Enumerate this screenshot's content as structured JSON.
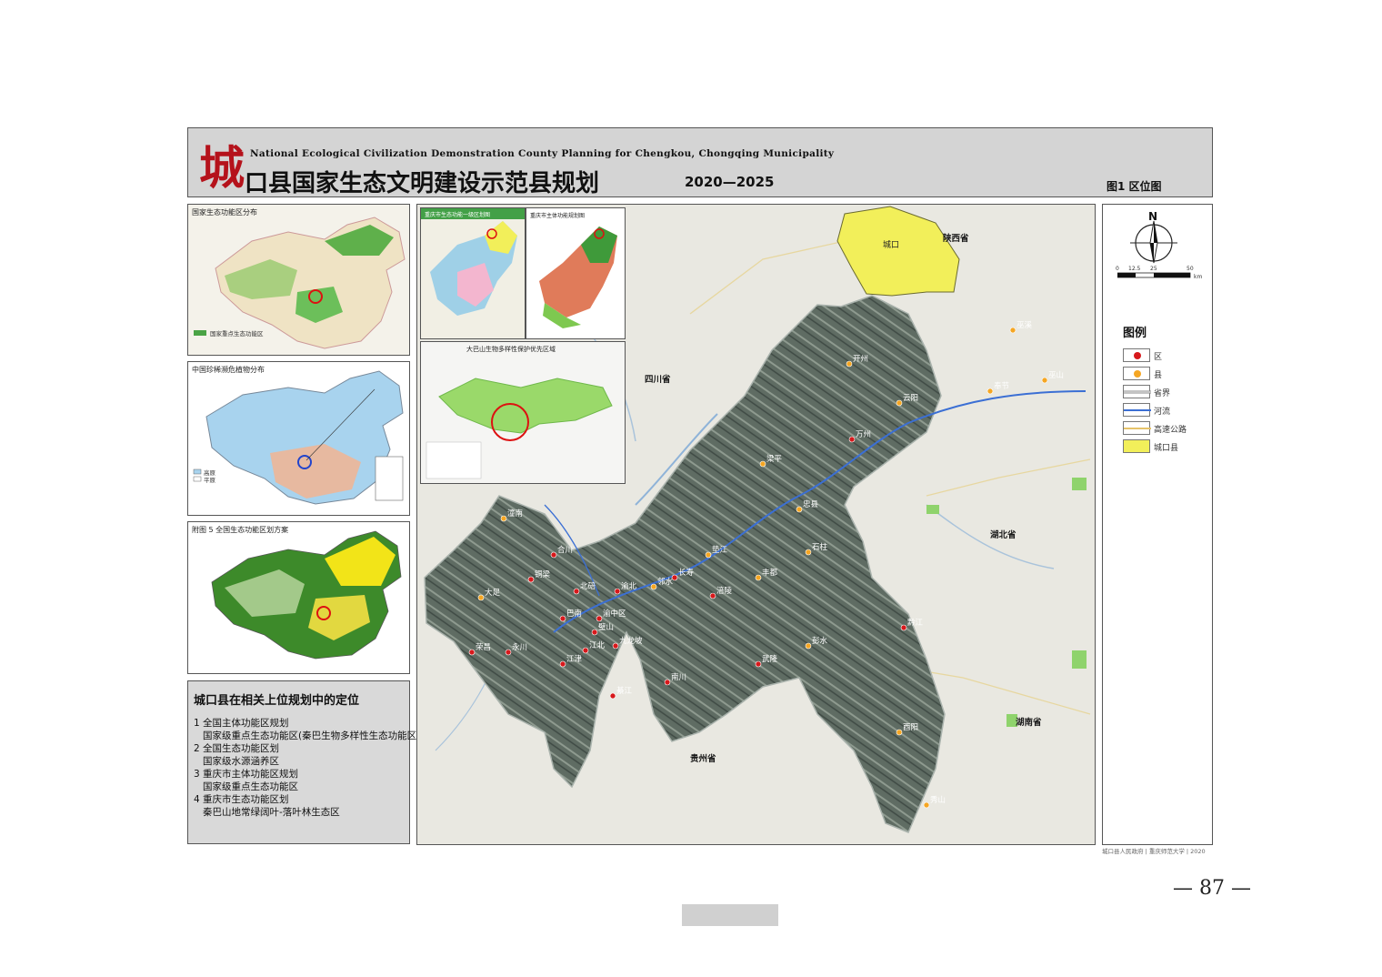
{
  "header": {
    "brand_char": "城",
    "subtitle_en": "National Ecological Civilization Demonstration County Planning for Chengkou, Chongqing Municipality",
    "title_cn": "口县国家生态文明建设示范县规划",
    "years": "2020—2025",
    "figure_label": "图1  区位图"
  },
  "inset_maps": {
    "national_eco_function": {
      "title": "国家生态功能区分布",
      "legend": "国家重点生态功能区"
    },
    "biodiversity": {
      "title": "中国珍稀濒危植物分布",
      "legend_items": [
        "高原",
        "平原"
      ]
    },
    "national_eco_zoning": {
      "title": "附图 5  全国生态功能区划方案"
    },
    "chongqing_functional": {
      "title": "重庆市生态功能一级区划图"
    },
    "chongqing_eco": {
      "title": "重庆市主体功能规划图"
    },
    "dabashan": {
      "title": "大巴山生物多样性保护优先区域"
    }
  },
  "positioning": {
    "title": "城口县在相关上位规划中的定位",
    "items": [
      {
        "heading": "1 全国主体功能区规划",
        "detail": "国家级重点生态功能区(秦巴生物多样性生态功能区)"
      },
      {
        "heading": "2 全国生态功能区划",
        "detail": "国家级水源涵养区"
      },
      {
        "heading": "3 重庆市主体功能区规划",
        "detail": "国家级重点生态功能区"
      },
      {
        "heading": "4 重庆市生态功能区划",
        "detail": "秦巴山地常绿阔叶-落叶林生态区"
      }
    ]
  },
  "main_map": {
    "highlight_label": "城口",
    "provinces": [
      "陕西省",
      "四川省",
      "湖北省",
      "湖南省",
      "贵州省"
    ],
    "places": [
      "万州",
      "开州",
      "云阳",
      "奉节",
      "巫山",
      "巫溪",
      "梁平",
      "忠县",
      "石柱",
      "丰都",
      "涪陵",
      "长寿",
      "垫江",
      "合川",
      "潼南",
      "铜梁",
      "大足",
      "荣昌",
      "永川",
      "江津",
      "綦江",
      "南川",
      "武隆",
      "彭水",
      "黔江",
      "酉阳",
      "秀山",
      "渝中区",
      "渝北",
      "北碚",
      "璧山",
      "江北",
      "九龙坡",
      "巴南",
      "邻水"
    ]
  },
  "legend": {
    "north": "N",
    "scale_ticks": [
      "0",
      "12.5",
      "25",
      "50"
    ],
    "scale_unit": "km",
    "title": "图例",
    "items": [
      {
        "label": "区",
        "type": "district",
        "color": "#d7191c"
      },
      {
        "label": "县",
        "type": "county",
        "color": "#f5a623"
      },
      {
        "label": "省界",
        "type": "province-border"
      },
      {
        "label": "河流",
        "type": "river",
        "color": "#3b6fd4"
      },
      {
        "label": "高速公路",
        "type": "highway",
        "color": "#e6c36a"
      },
      {
        "label": "城口县",
        "type": "county-area",
        "color": "#f2ef5a"
      }
    ]
  },
  "source_note": "城口县人民政府 | 重庆师范大学 | 2020",
  "page": {
    "number": "— 87 —"
  }
}
